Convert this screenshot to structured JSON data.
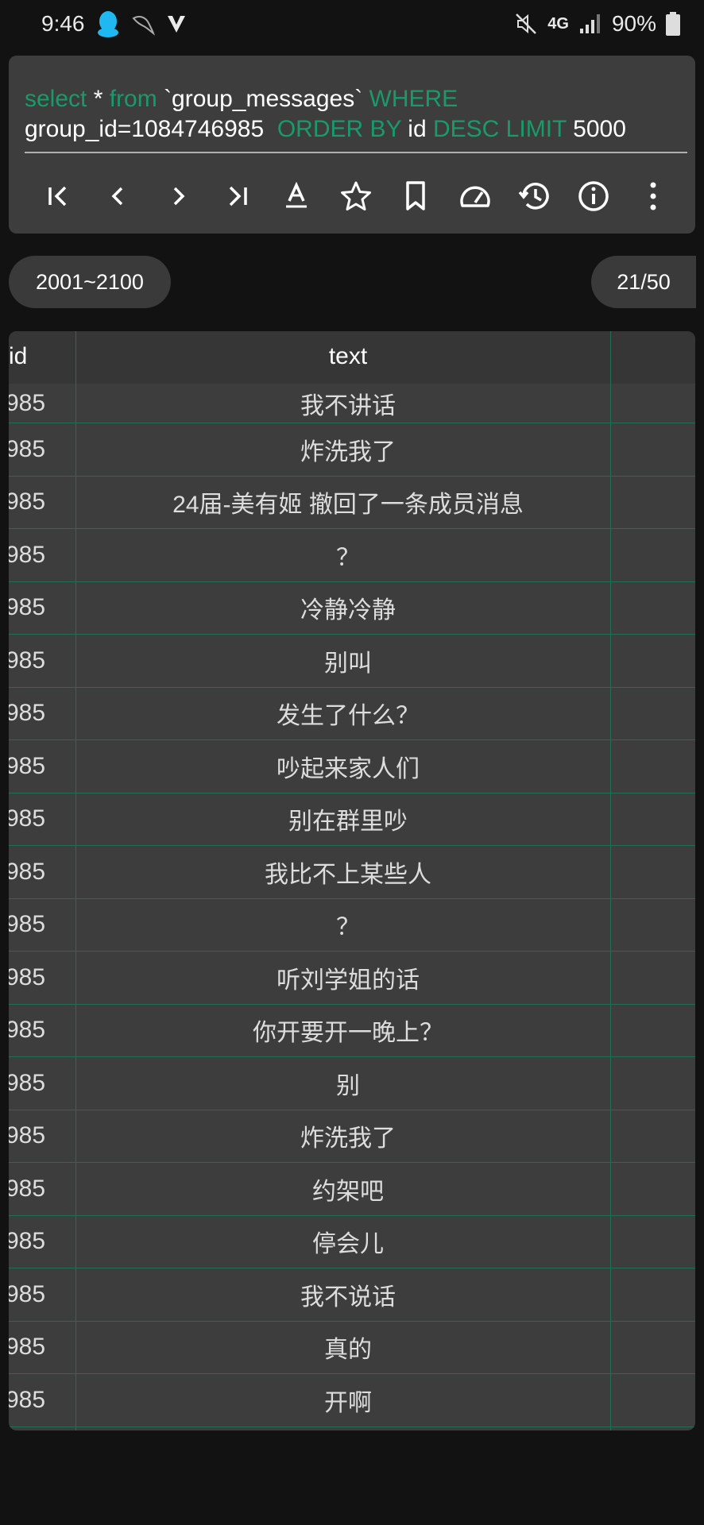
{
  "status_bar": {
    "time": "9:46",
    "network": "4G",
    "battery": "90%"
  },
  "query": {
    "kw_select": "select",
    "star": " * ",
    "kw_from": "from",
    "table": " `group_messages` ",
    "kw_where": "WHERE",
    "condition": "group_id=1084746985  ",
    "kw_order": "ORDER BY",
    "order_col": " id ",
    "kw_desc_limit": "DESC LIMIT",
    "limit": " 5000"
  },
  "toolbar": {
    "icons": [
      "first-page-icon",
      "prev-page-icon",
      "next-page-icon",
      "last-page-icon",
      "text-format-icon",
      "star-icon",
      "bookmark-icon",
      "speed-icon",
      "history-icon",
      "info-icon",
      "more-icon"
    ]
  },
  "pagination": {
    "range": "2001~2100",
    "page": "21/50"
  },
  "table": {
    "columns": [
      "id",
      "text"
    ],
    "rows": [
      {
        "id": "985",
        "text": "我不讲话"
      },
      {
        "id": "985",
        "text": "炸洗我了"
      },
      {
        "id": "985",
        "text": "24届-美有姬 撤回了一条成员消息"
      },
      {
        "id": "985",
        "text": "？"
      },
      {
        "id": "985",
        "text": "冷静冷静"
      },
      {
        "id": "985",
        "text": "别叫"
      },
      {
        "id": "985",
        "text": "发生了什么？"
      },
      {
        "id": "985",
        "text": "吵起来家人们"
      },
      {
        "id": "985",
        "text": "别在群里吵"
      },
      {
        "id": "985",
        "text": "我比不上某些人"
      },
      {
        "id": "985",
        "text": "？"
      },
      {
        "id": "985",
        "text": "听刘学姐的话"
      },
      {
        "id": "985",
        "text": "你开要开一晚上？"
      },
      {
        "id": "985",
        "text": "别"
      },
      {
        "id": "985",
        "text": "炸洗我了"
      },
      {
        "id": "985",
        "text": "约架吧"
      },
      {
        "id": "985",
        "text": "停会儿"
      },
      {
        "id": "985",
        "text": "我不说话"
      },
      {
        "id": "985",
        "text": "真的"
      },
      {
        "id": "985",
        "text": "开啊"
      }
    ]
  },
  "colors": {
    "keyword": "#1a9a6a",
    "panel": "#3d3d3d",
    "background": "#121212",
    "grid": "#1f6f52"
  }
}
